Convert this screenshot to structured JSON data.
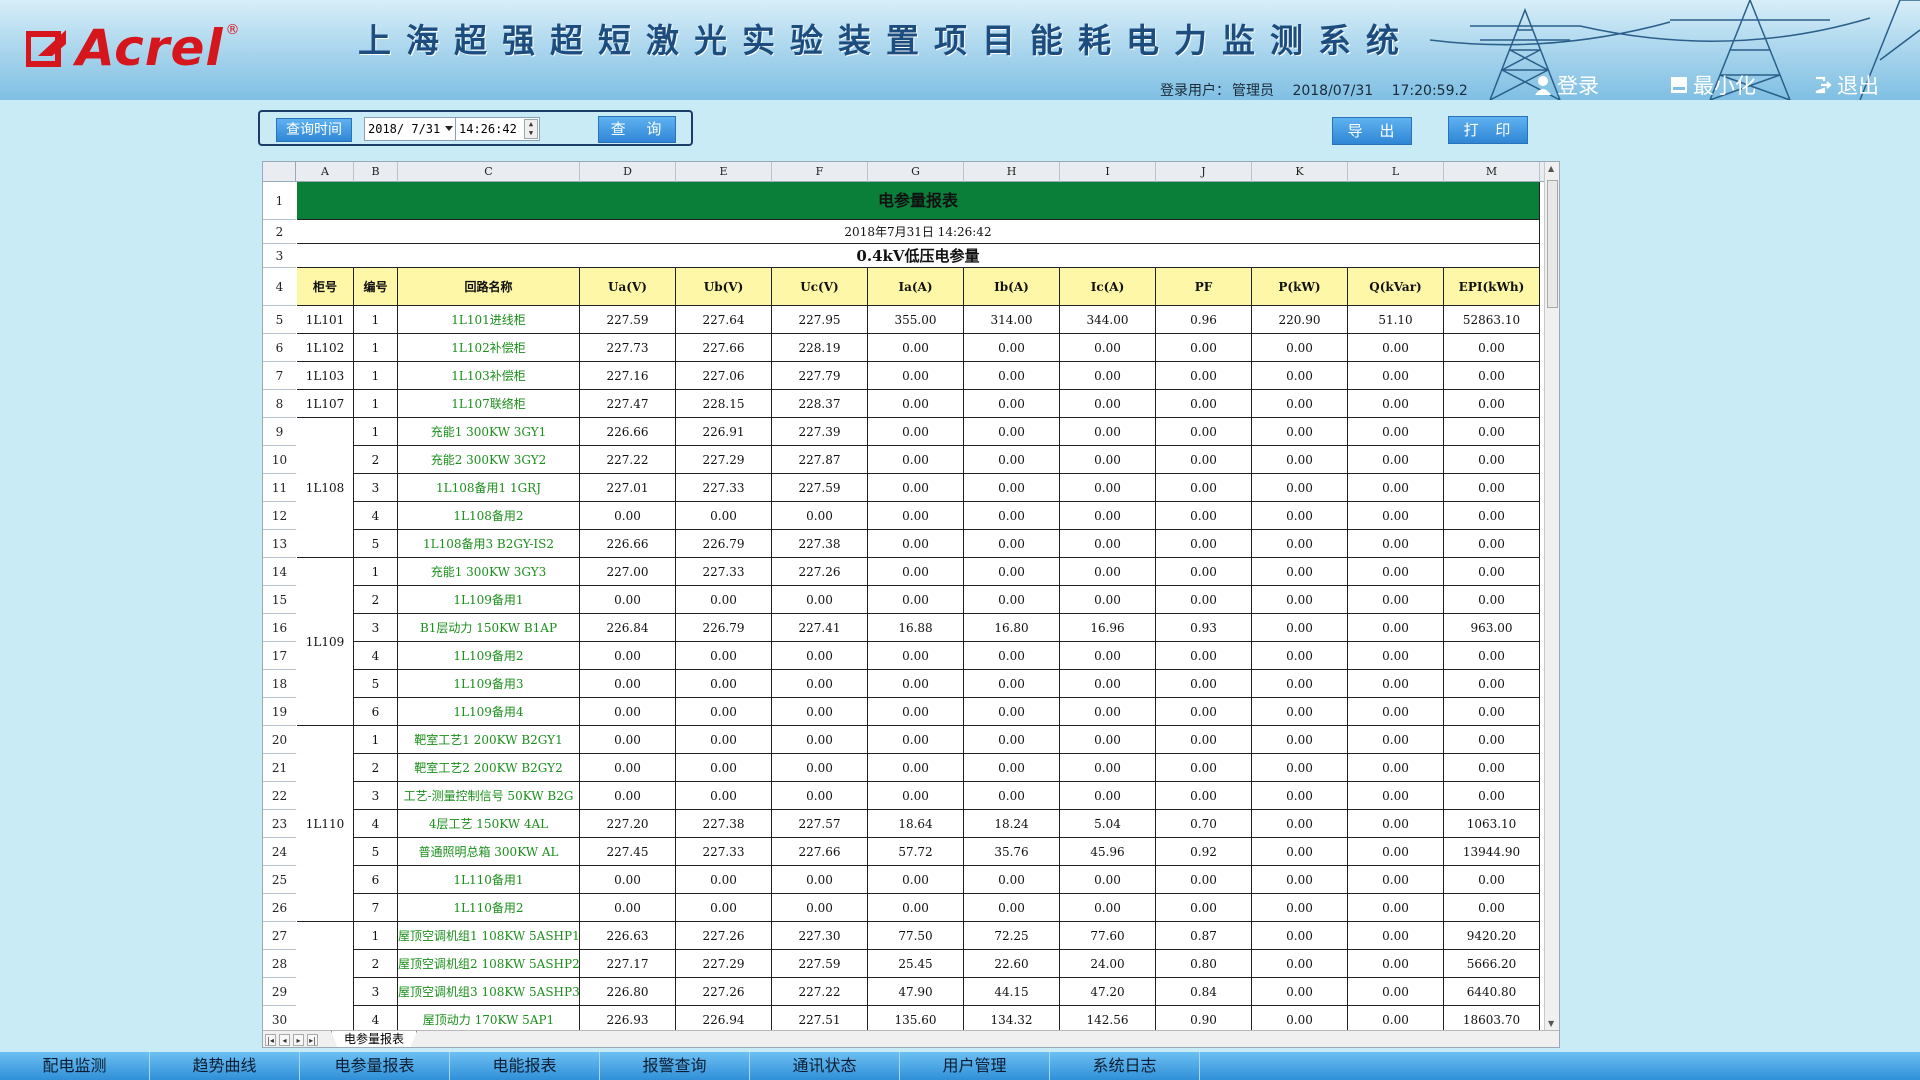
{
  "header": {
    "logo_text": "Acrel",
    "logo_reg": "®",
    "system_title": "上海超强超短激光实验装置项目能耗电力监测系统",
    "login_label": "登录用户：",
    "login_user": "管理员",
    "date": "2018/07/31",
    "time": "17:20:59.2",
    "login_button": "登录",
    "minimize_button": "最小化",
    "logout_button": "退出"
  },
  "query": {
    "label": "查询时间",
    "date_value": "2018/ 7/31",
    "time_value": "14:26:42",
    "query_button": "查 询",
    "export_button": "导 出",
    "print_button": "打 印"
  },
  "sheet": {
    "columns": [
      "A",
      "B",
      "C",
      "D",
      "E",
      "F",
      "G",
      "H",
      "I",
      "J",
      "K",
      "L",
      "M"
    ],
    "title": "电参量报表",
    "datetime": "2018年7月31日 14:26:42",
    "section": "0.4kV低压电参量",
    "headers": [
      "柜号",
      "编号",
      "回路名称",
      "Ua(V)",
      "Ub(V)",
      "Uc(V)",
      "Ia(A)",
      "Ib(A)",
      "Ic(A)",
      "PF",
      "P(kW)",
      "Q(kVar)",
      "EPI(kWh)"
    ],
    "groups": [
      {
        "cabinet": "1L101",
        "rows": [
          [
            "1",
            "1L101进线柜",
            "227.59",
            "227.64",
            "227.95",
            "355.00",
            "314.00",
            "344.00",
            "0.96",
            "220.90",
            "51.10",
            "52863.10"
          ]
        ]
      },
      {
        "cabinet": "1L102",
        "rows": [
          [
            "1",
            "1L102补偿柜",
            "227.73",
            "227.66",
            "228.19",
            "0.00",
            "0.00",
            "0.00",
            "0.00",
            "0.00",
            "0.00",
            "0.00"
          ]
        ]
      },
      {
        "cabinet": "1L103",
        "rows": [
          [
            "1",
            "1L103补偿柜",
            "227.16",
            "227.06",
            "227.79",
            "0.00",
            "0.00",
            "0.00",
            "0.00",
            "0.00",
            "0.00",
            "0.00"
          ]
        ]
      },
      {
        "cabinet": "1L107",
        "rows": [
          [
            "1",
            "1L107联络柜",
            "227.47",
            "228.15",
            "228.37",
            "0.00",
            "0.00",
            "0.00",
            "0.00",
            "0.00",
            "0.00",
            "0.00"
          ]
        ]
      },
      {
        "cabinet": "1L108",
        "rows": [
          [
            "1",
            "充能1 300KW 3GY1",
            "226.66",
            "226.91",
            "227.39",
            "0.00",
            "0.00",
            "0.00",
            "0.00",
            "0.00",
            "0.00",
            "0.00"
          ],
          [
            "2",
            "充能2 300KW 3GY2",
            "227.22",
            "227.29",
            "227.87",
            "0.00",
            "0.00",
            "0.00",
            "0.00",
            "0.00",
            "0.00",
            "0.00"
          ],
          [
            "3",
            "1L108备用1 1GRJ",
            "227.01",
            "227.33",
            "227.59",
            "0.00",
            "0.00",
            "0.00",
            "0.00",
            "0.00",
            "0.00",
            "0.00"
          ],
          [
            "4",
            "1L108备用2",
            "0.00",
            "0.00",
            "0.00",
            "0.00",
            "0.00",
            "0.00",
            "0.00",
            "0.00",
            "0.00",
            "0.00"
          ],
          [
            "5",
            "1L108备用3 B2GY-IS2",
            "226.66",
            "226.79",
            "227.38",
            "0.00",
            "0.00",
            "0.00",
            "0.00",
            "0.00",
            "0.00",
            "0.00"
          ]
        ]
      },
      {
        "cabinet": "1L109",
        "rows": [
          [
            "1",
            "充能1 300KW 3GY3",
            "227.00",
            "227.33",
            "227.26",
            "0.00",
            "0.00",
            "0.00",
            "0.00",
            "0.00",
            "0.00",
            "0.00"
          ],
          [
            "2",
            "1L109备用1",
            "0.00",
            "0.00",
            "0.00",
            "0.00",
            "0.00",
            "0.00",
            "0.00",
            "0.00",
            "0.00",
            "0.00"
          ],
          [
            "3",
            "B1层动力 150KW B1AP",
            "226.84",
            "226.79",
            "227.41",
            "16.88",
            "16.80",
            "16.96",
            "0.93",
            "0.00",
            "0.00",
            "963.00"
          ],
          [
            "4",
            "1L109备用2",
            "0.00",
            "0.00",
            "0.00",
            "0.00",
            "0.00",
            "0.00",
            "0.00",
            "0.00",
            "0.00",
            "0.00"
          ],
          [
            "5",
            "1L109备用3",
            "0.00",
            "0.00",
            "0.00",
            "0.00",
            "0.00",
            "0.00",
            "0.00",
            "0.00",
            "0.00",
            "0.00"
          ],
          [
            "6",
            "1L109备用4",
            "0.00",
            "0.00",
            "0.00",
            "0.00",
            "0.00",
            "0.00",
            "0.00",
            "0.00",
            "0.00",
            "0.00"
          ]
        ]
      },
      {
        "cabinet": "1L110",
        "rows": [
          [
            "1",
            "靶室工艺1 200KW B2GY1",
            "0.00",
            "0.00",
            "0.00",
            "0.00",
            "0.00",
            "0.00",
            "0.00",
            "0.00",
            "0.00",
            "0.00"
          ],
          [
            "2",
            "靶室工艺2 200KW B2GY2",
            "0.00",
            "0.00",
            "0.00",
            "0.00",
            "0.00",
            "0.00",
            "0.00",
            "0.00",
            "0.00",
            "0.00"
          ],
          [
            "3",
            "工艺-测量控制信号 50KW B2G",
            "0.00",
            "0.00",
            "0.00",
            "0.00",
            "0.00",
            "0.00",
            "0.00",
            "0.00",
            "0.00",
            "0.00"
          ],
          [
            "4",
            "4层工艺 150KW 4AL",
            "227.20",
            "227.38",
            "227.57",
            "18.64",
            "18.24",
            "5.04",
            "0.70",
            "0.00",
            "0.00",
            "1063.10"
          ],
          [
            "5",
            "普通照明总箱 300KW AL",
            "227.45",
            "227.33",
            "227.66",
            "57.72",
            "35.76",
            "45.96",
            "0.92",
            "0.00",
            "0.00",
            "13944.90"
          ],
          [
            "6",
            "1L110备用1",
            "0.00",
            "0.00",
            "0.00",
            "0.00",
            "0.00",
            "0.00",
            "0.00",
            "0.00",
            "0.00",
            "0.00"
          ],
          [
            "7",
            "1L110备用2",
            "0.00",
            "0.00",
            "0.00",
            "0.00",
            "0.00",
            "0.00",
            "0.00",
            "0.00",
            "0.00",
            "0.00"
          ]
        ]
      },
      {
        "cabinet": "",
        "rows": [
          [
            "1",
            "屋顶空调机组1 108KW 5ASHP1",
            "226.63",
            "227.26",
            "227.30",
            "77.50",
            "72.25",
            "77.60",
            "0.87",
            "0.00",
            "0.00",
            "9420.20"
          ],
          [
            "2",
            "屋顶空调机组2 108KW 5ASHP2",
            "227.17",
            "227.29",
            "227.59",
            "25.45",
            "22.60",
            "24.00",
            "0.80",
            "0.00",
            "0.00",
            "5666.20"
          ],
          [
            "3",
            "屋顶空调机组3 108KW 5ASHP3",
            "226.80",
            "227.26",
            "227.22",
            "47.90",
            "44.15",
            "47.20",
            "0.84",
            "0.00",
            "0.00",
            "6440.80"
          ],
          [
            "4",
            "屋顶动力 170KW 5AP1",
            "226.93",
            "226.94",
            "227.51",
            "135.60",
            "134.32",
            "142.56",
            "0.90",
            "0.00",
            "0.00",
            "18603.70"
          ]
        ]
      }
    ],
    "sheet_tab": "电参量报表"
  },
  "nav": [
    "配电监测",
    "趋势曲线",
    "电参量报表",
    "电能报表",
    "报警查询",
    "通讯状态",
    "用户管理",
    "系统日志"
  ],
  "colors": {
    "title_green": "#0a7f3a",
    "header_yellow": "#fff7a8",
    "name_green": "#1b8f1b",
    "logo_red": "#d5161c"
  }
}
